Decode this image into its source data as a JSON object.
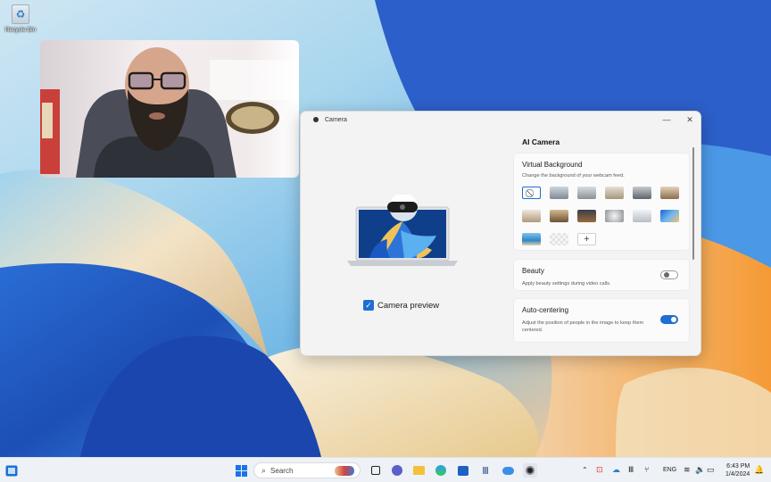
{
  "desktop": {
    "recycle_bin_label": "Recycle Bin"
  },
  "camera_window": {
    "title": "Camera",
    "minimize_glyph": "—",
    "close_glyph": "✕",
    "camera_preview_label": "Camera preview",
    "camera_preview_checked": true,
    "panel_title": "AI Camera",
    "virtual_background": {
      "title": "Virtual Background",
      "description": "Change the background of your webcam feed.",
      "add_glyph": "+"
    },
    "beauty": {
      "title": "Beauty",
      "description": "Apply beauty settings during video calls.",
      "enabled": false
    },
    "auto_centering": {
      "title": "Auto-centering",
      "description": "Adjust the position of people in the image to keep them centered.",
      "enabled": true
    }
  },
  "taskbar": {
    "search_placeholder": "Search",
    "language": "ENG",
    "time": "6:43 PM",
    "date": "1/4/2024"
  },
  "colors": {
    "accent": "#1f6fd1",
    "toggle_off": "#c9c9c9"
  }
}
